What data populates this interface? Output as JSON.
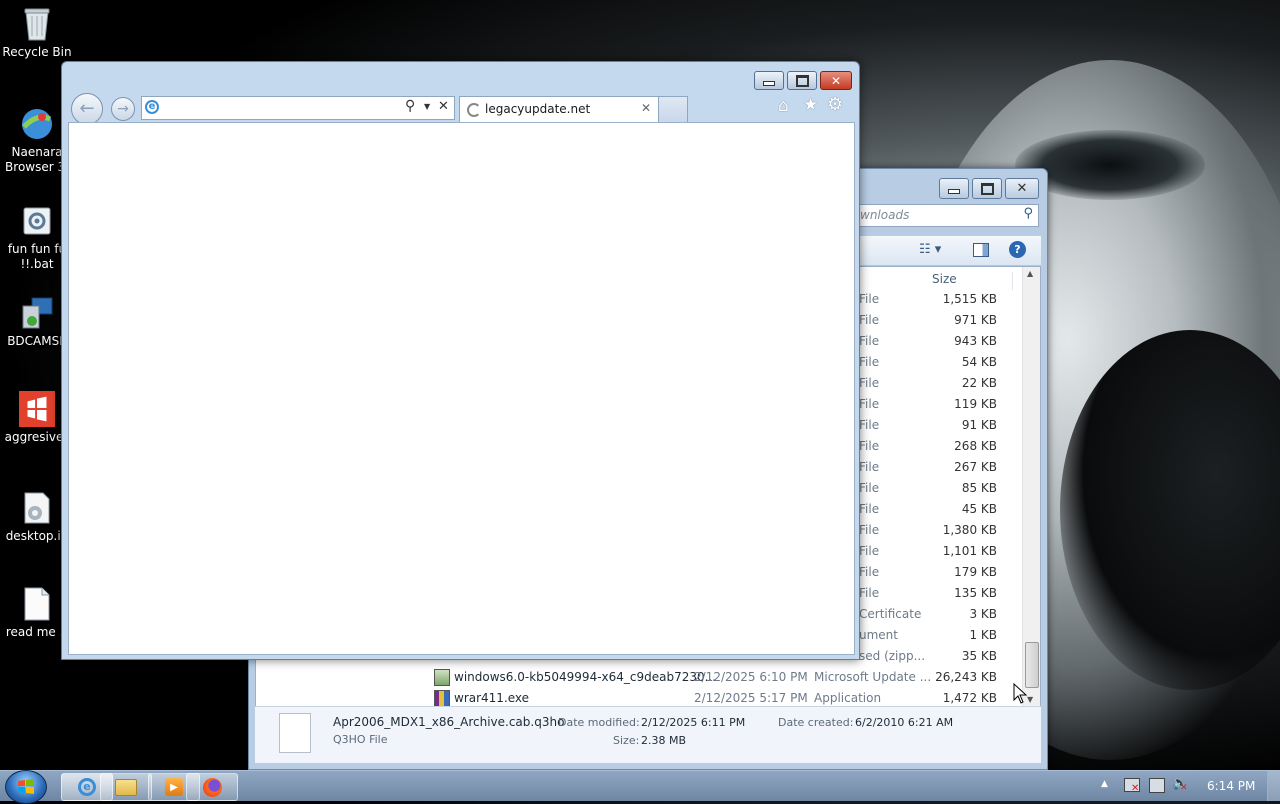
{
  "desktop": {
    "icons": [
      {
        "label": "Recycle Bin",
        "icon": "recycle-bin-icon"
      },
      {
        "label": "Naenara\nBrowser 3.",
        "icon": "globe-icon"
      },
      {
        "label": "fun fun fu\n!!.bat",
        "icon": "batch-file-icon"
      },
      {
        "label": "BDCAMSE",
        "icon": "installer-icon"
      },
      {
        "label": "aggresive_",
        "icon": "windows-logo-icon"
      },
      {
        "label": "desktop.in",
        "icon": "settings-file-icon"
      },
      {
        "label": "read me .t",
        "icon": "text-file-icon"
      }
    ]
  },
  "ie": {
    "address_value": "",
    "tab_title": "legacyupdate.net"
  },
  "explorer": {
    "search_placeholder": "wnloads",
    "size_header": "Size",
    "rows": [
      {
        "type": "File",
        "size": "1,515 KB"
      },
      {
        "type": "File",
        "size": "971 KB"
      },
      {
        "type": "File",
        "size": "943 KB"
      },
      {
        "type": "File",
        "size": "54 KB"
      },
      {
        "type": "File",
        "size": "22 KB"
      },
      {
        "type": "File",
        "size": "119 KB"
      },
      {
        "type": "File",
        "size": "91 KB"
      },
      {
        "type": "File",
        "size": "268 KB"
      },
      {
        "type": "File",
        "size": "267 KB"
      },
      {
        "type": "File",
        "size": "85 KB"
      },
      {
        "type": "File",
        "size": "45 KB"
      },
      {
        "type": "File",
        "size": "1,380 KB"
      },
      {
        "type": "File",
        "size": "1,101 KB"
      },
      {
        "type": "File",
        "size": "179 KB"
      },
      {
        "type": "File",
        "size": "135 KB"
      },
      {
        "type": "Certificate",
        "size": "3 KB"
      },
      {
        "type": "ument",
        "size": "1 KB"
      },
      {
        "type": "sed (zipp...",
        "size": "35 KB"
      }
    ],
    "full_rows": [
      {
        "name": "windows6.0-kb5049994-x64_c9deab7230...",
        "date": "2/12/2025 6:10 PM",
        "type": "Microsoft Update ...",
        "size": "26,243 KB"
      },
      {
        "name": "wrar411.exe",
        "date": "2/12/2025 5:17 PM",
        "type": "Application",
        "size": "1,472 KB"
      }
    ],
    "details": {
      "filename": "Apr2006_MDX1_x86_Archive.cab.q3ho",
      "filetype": "Q3HO File",
      "modified_label": "Date modified:",
      "modified_value": "2/12/2025 6:11 PM",
      "created_label": "Date created:",
      "created_value": "6/2/2010 6:21 AM",
      "size_label": "Size:",
      "size_value": "2.38 MB"
    }
  },
  "taskbar": {
    "clock": "6:14 PM"
  }
}
